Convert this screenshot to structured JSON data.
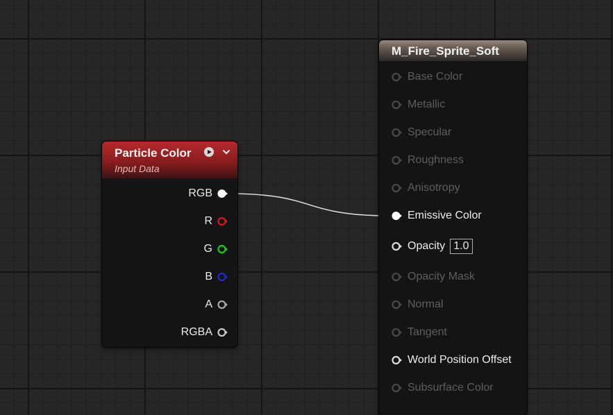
{
  "particle_node": {
    "title": "Particle Color",
    "subtitle": "Input Data",
    "outputs": [
      {
        "label": "RGB",
        "color": "#ffffff",
        "connected": true
      },
      {
        "label": "R",
        "color": "#e01515"
      },
      {
        "label": "G",
        "color": "#14d114"
      },
      {
        "label": "B",
        "color": "#1d2ad6"
      },
      {
        "label": "A",
        "color": "#a8a8a8"
      },
      {
        "label": "RGBA",
        "color": "#c8c8c8"
      }
    ]
  },
  "material_node": {
    "title": "M_Fire_Sprite_Soft",
    "inputs": [
      {
        "label": "Base Color",
        "active": false
      },
      {
        "label": "Metallic",
        "active": false
      },
      {
        "label": "Specular",
        "active": false
      },
      {
        "label": "Roughness",
        "active": false
      },
      {
        "label": "Anisotropy",
        "active": false
      },
      {
        "label": "Emissive Color",
        "active": true,
        "connected": true
      },
      {
        "label": "Opacity",
        "active": true,
        "value": "1.0"
      },
      {
        "label": "Opacity Mask",
        "active": false
      },
      {
        "label": "Normal",
        "active": false
      },
      {
        "label": "Tangent",
        "active": false
      },
      {
        "label": "World Position Offset",
        "active": true
      },
      {
        "label": "Subsurface Color",
        "active": false
      }
    ]
  },
  "wire": {
    "from": "RGB",
    "to": "Emissive Color",
    "color": "#dcdcdc"
  }
}
